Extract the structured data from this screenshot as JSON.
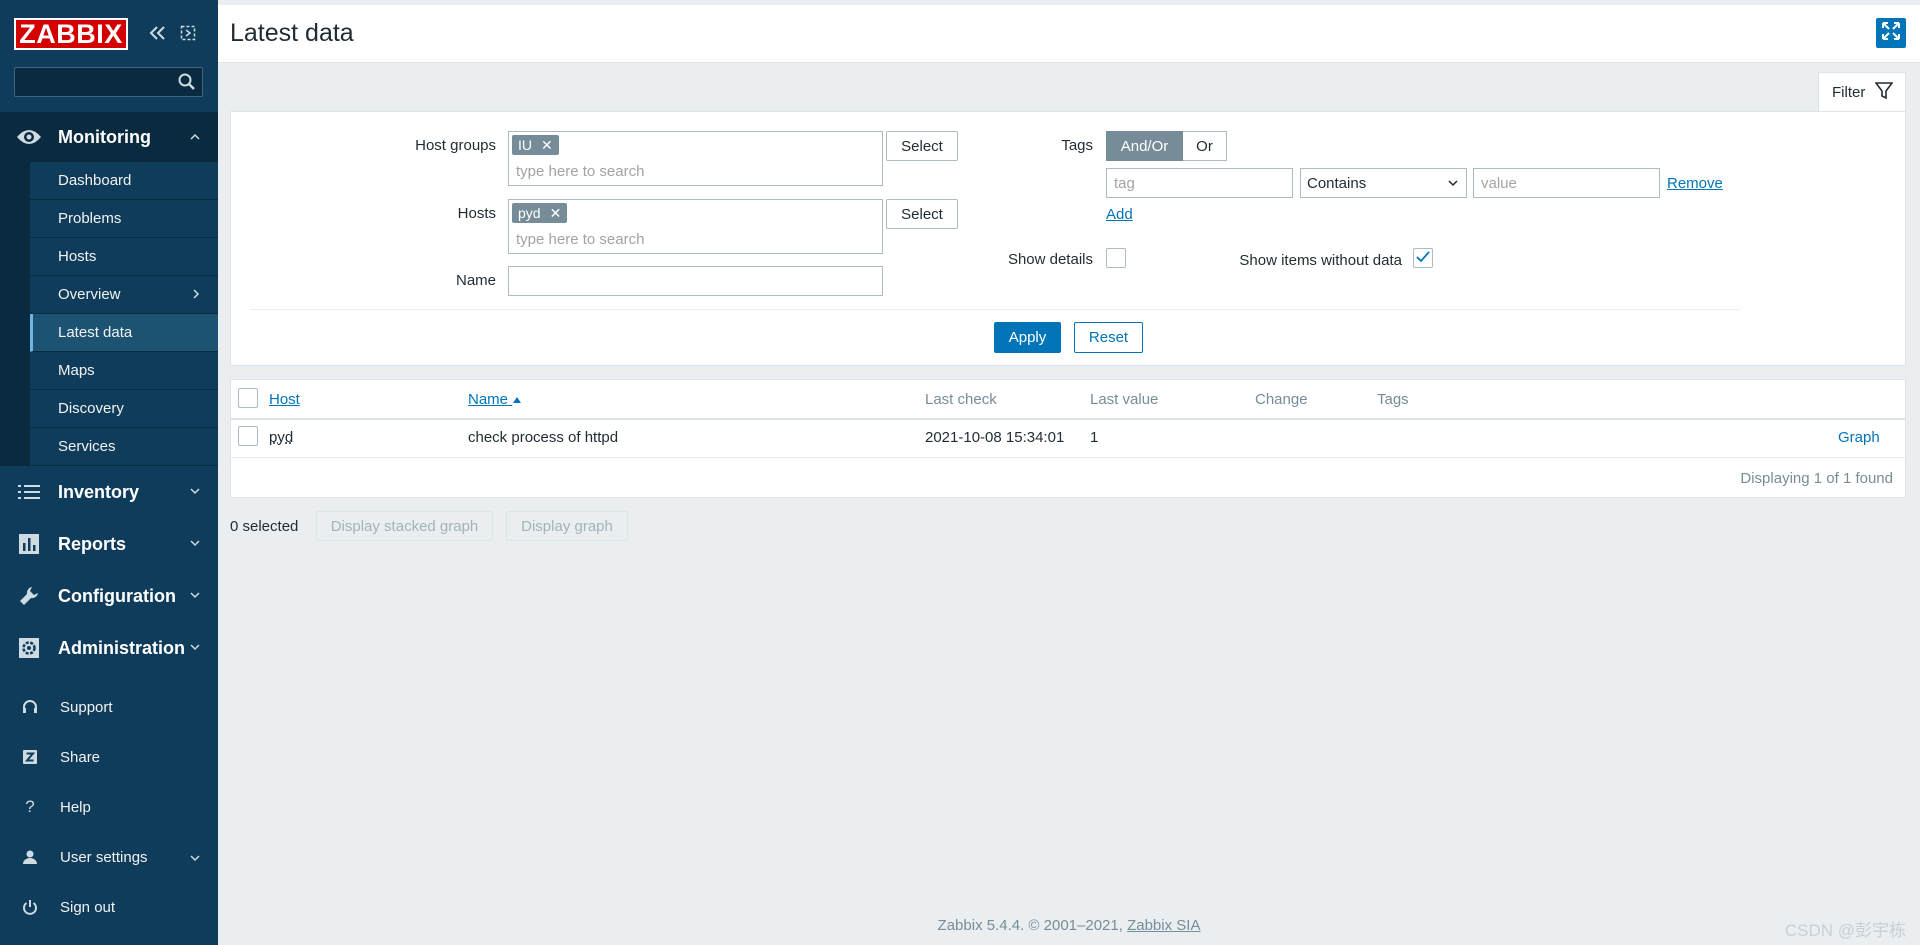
{
  "app": {
    "logo": "ZABBIX",
    "page_title": "Latest data",
    "colors": {
      "sidebar": "#0e3c5a",
      "accent": "#0275b8",
      "logo_red": "#d40000"
    }
  },
  "sidebar": {
    "search_placeholder": "",
    "monitoring": {
      "label": "Monitoring",
      "items": [
        {
          "label": "Dashboard"
        },
        {
          "label": "Problems"
        },
        {
          "label": "Hosts"
        },
        {
          "label": "Overview"
        },
        {
          "label": "Latest data"
        },
        {
          "label": "Maps"
        },
        {
          "label": "Discovery"
        },
        {
          "label": "Services"
        }
      ]
    },
    "sections": [
      {
        "label": "Inventory",
        "icon": "list-icon"
      },
      {
        "label": "Reports",
        "icon": "bar-chart-icon"
      },
      {
        "label": "Configuration",
        "icon": "wrench-icon"
      },
      {
        "label": "Administration",
        "icon": "cog-icon"
      }
    ],
    "bottom": [
      {
        "label": "Support",
        "icon": "headset-icon"
      },
      {
        "label": "Share",
        "icon": "share-icon"
      },
      {
        "label": "Help",
        "icon": "help-icon"
      },
      {
        "label": "User settings",
        "icon": "user-icon"
      },
      {
        "label": "Sign out",
        "icon": "power-icon"
      }
    ]
  },
  "filter": {
    "tab_label": "Filter",
    "host_groups_label": "Host groups",
    "host_groups_chip": "IU",
    "hosts_label": "Hosts",
    "hosts_chip": "pyd",
    "search_placeholder": "type here to search",
    "select_label": "Select",
    "name_label": "Name",
    "name_value": "",
    "tags_label": "Tags",
    "tag_mode_andor": "And/Or",
    "tag_mode_or": "Or",
    "tag_placeholder": "tag",
    "operator_value": "Contains",
    "value_placeholder": "value",
    "remove_label": "Remove",
    "add_label": "Add",
    "show_details_label": "Show details",
    "show_details_checked": false,
    "show_without_data_label": "Show items without data",
    "show_without_data_checked": true,
    "apply_label": "Apply",
    "reset_label": "Reset"
  },
  "table": {
    "columns": {
      "host": "Host",
      "name": "Name",
      "last_check": "Last check",
      "last_value": "Last value",
      "change": "Change",
      "tags": "Tags"
    },
    "rows": [
      {
        "host": "pyd",
        "name": "check process of httpd",
        "last_check": "2021-10-08 15:34:01",
        "last_value": "1",
        "change": "",
        "tags": "",
        "action": "Graph"
      }
    ],
    "footer": "Displaying 1 of 1 found"
  },
  "bulk": {
    "selected": "0 selected",
    "stacked_graph": "Display stacked graph",
    "graph": "Display graph"
  },
  "footer": {
    "text": "Zabbix 5.4.4. © 2001–2021,",
    "link": "Zabbix SIA"
  },
  "watermark": "CSDN @彭宇栋"
}
